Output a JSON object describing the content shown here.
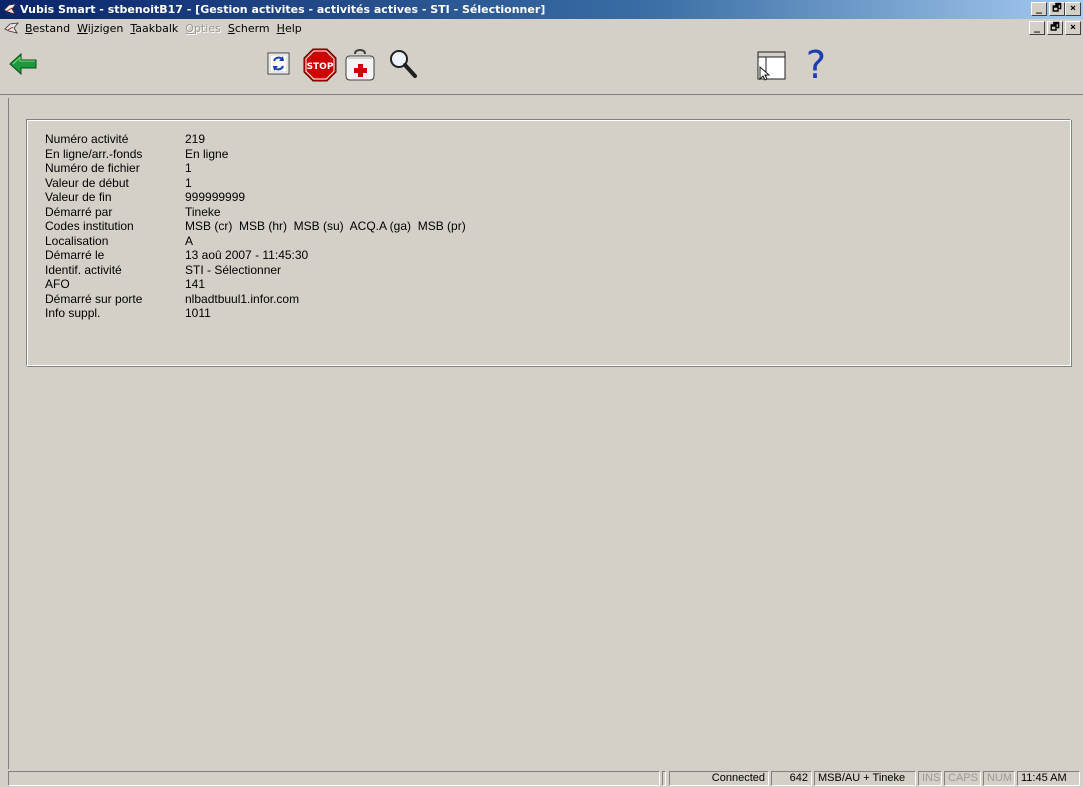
{
  "window": {
    "title": "Vubis Smart - stbenoitB17 - [Gestion activites - activités actives - STI - Sélectionner]",
    "minimize": "_",
    "restore": "🗗",
    "close": "×"
  },
  "menu": {
    "items": [
      {
        "acc": "B",
        "rest": "estand",
        "enabled": true
      },
      {
        "acc": "W",
        "rest": "ijzigen",
        "enabled": true
      },
      {
        "acc": "T",
        "rest": "aakbalk",
        "enabled": true
      },
      {
        "acc": "O",
        "rest": "pties",
        "enabled": false
      },
      {
        "acc": "S",
        "rest": "cherm",
        "enabled": true
      },
      {
        "acc": "H",
        "rest": "elp",
        "enabled": true
      }
    ]
  },
  "toolbar": {
    "icons": [
      "back-arrow-icon",
      "refresh-icon",
      "stop-icon",
      "first-aid-icon",
      "search-icon",
      "window-layout-icon",
      "help-icon"
    ],
    "stop_label": "STOP",
    "help_glyph": "?"
  },
  "colors": {
    "titlebar_start": "#0a246a",
    "titlebar_end": "#a6caf0",
    "back_arrow": "#1a9a3a",
    "stop": "#cc0000",
    "help": "#1c3fb0"
  },
  "details": {
    "fields": [
      {
        "label": "Numéro activité",
        "value": "219"
      },
      {
        "label": "En ligne/arr.-fonds",
        "value": "En ligne"
      },
      {
        "label": "Numéro de fichier",
        "value": "1"
      },
      {
        "label": "Valeur de début",
        "value": "1"
      },
      {
        "label": "Valeur de fin",
        "value": "999999999"
      },
      {
        "label": "Démarré par",
        "value": "Tineke"
      },
      {
        "label": "Codes institution",
        "value": "MSB (cr)  MSB (hr)  MSB (su)  ACQ.A (ga)  MSB (pr)"
      },
      {
        "label": "Localisation",
        "value": "A"
      },
      {
        "label": "Démarré le",
        "value": "13 aoû 2007 - 11:45:30"
      },
      {
        "label": "Identif. activité",
        "value": "STI - Sélectionner"
      },
      {
        "label": "AFO",
        "value": "141"
      },
      {
        "label": "Démarré sur porte",
        "value": "nlbadtbuul1.infor.com"
      },
      {
        "label": "Info suppl.",
        "value": "1011"
      }
    ]
  },
  "status": {
    "connection": "Connected",
    "count": "642",
    "user": "MSB/AU + Tineke",
    "ins": "INS",
    "caps": "CAPS",
    "num": "NUM",
    "time": "11:45 AM"
  }
}
